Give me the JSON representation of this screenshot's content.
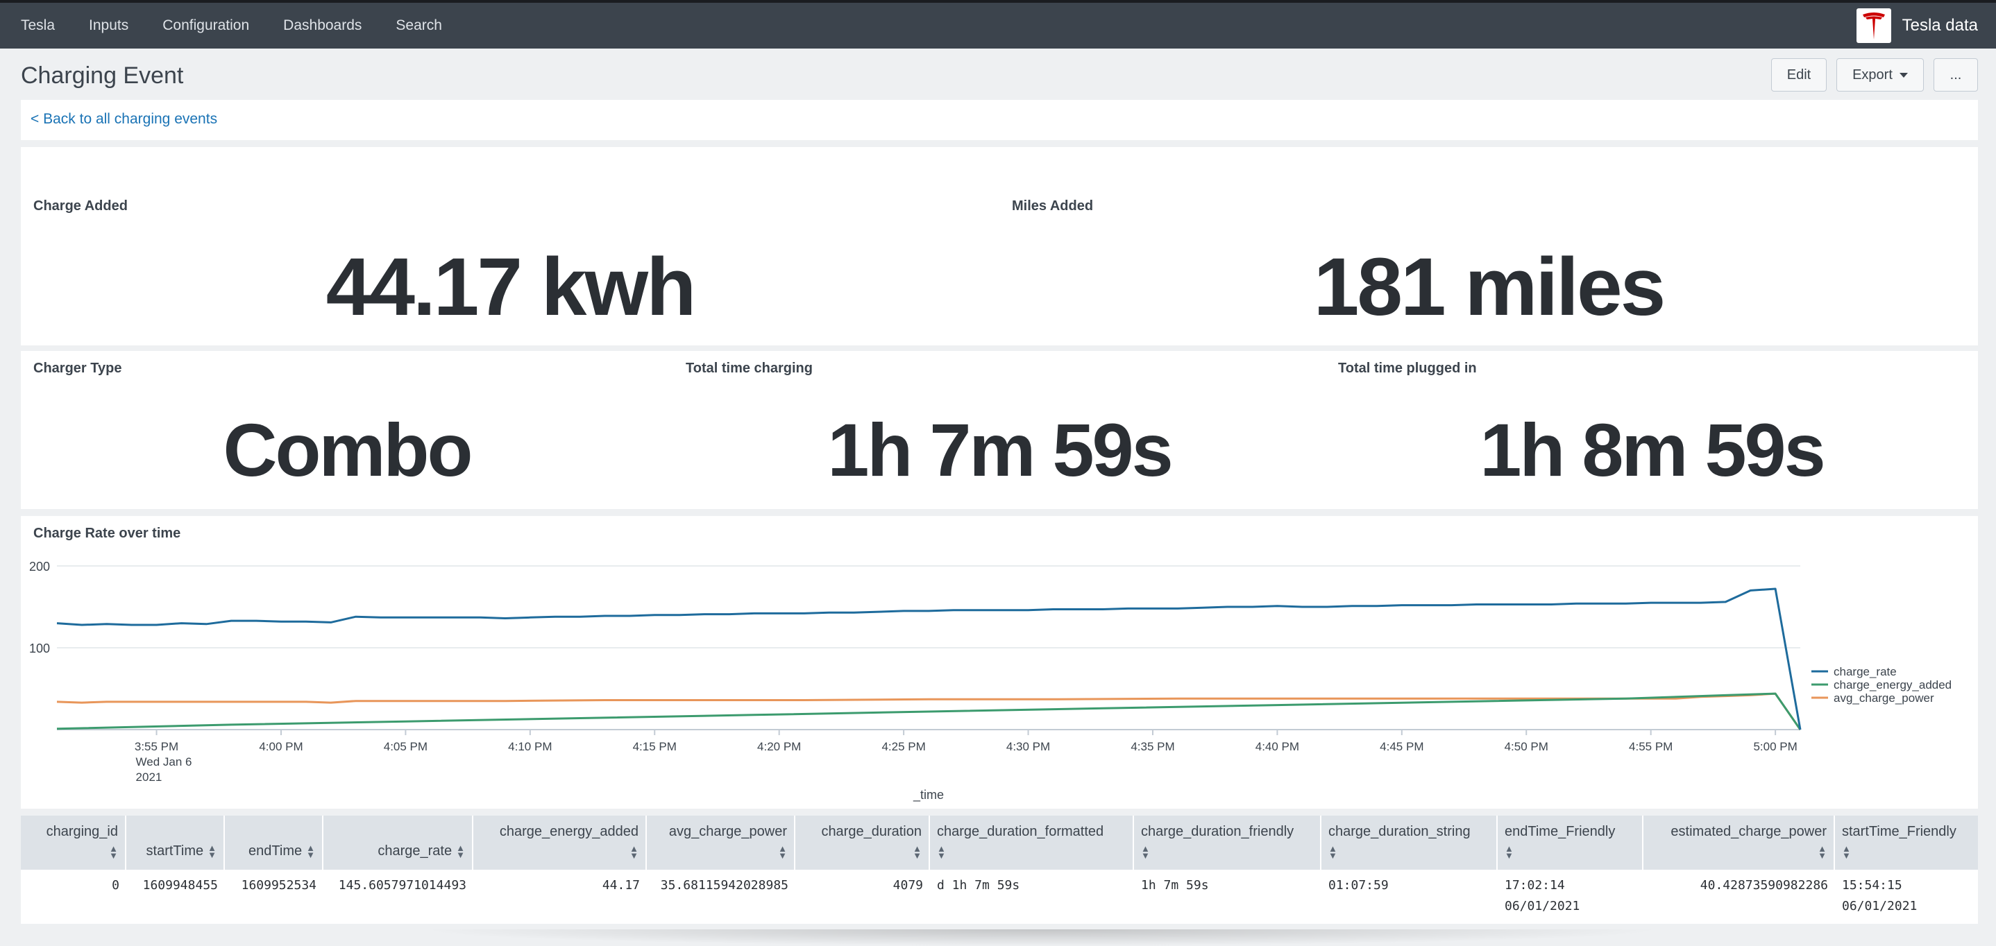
{
  "nav": {
    "items": [
      "Tesla",
      "Inputs",
      "Configuration",
      "Dashboards",
      "Search"
    ],
    "brand": "Tesla data"
  },
  "header": {
    "title": "Charging Event",
    "edit_label": "Edit",
    "export_label": "Export",
    "more_label": "..."
  },
  "back_link": "< Back to all charging events",
  "stats": {
    "charge_added": {
      "label": "Charge Added",
      "value": "44.17 kwh"
    },
    "miles_added": {
      "label": "Miles Added",
      "value": "181 miles"
    },
    "charger_type": {
      "label": "Charger Type",
      "value": "Combo"
    },
    "total_time_charging": {
      "label": "Total time charging",
      "value": "1h 7m 59s"
    },
    "total_time_plugged": {
      "label": "Total time plugged in",
      "value": "1h 8m 59s"
    }
  },
  "chart_data": {
    "type": "line",
    "title": "Charge Rate over time",
    "xlabel": "_time",
    "ylabel": "",
    "ylim": [
      0,
      200
    ],
    "y_ticks": [
      100,
      200
    ],
    "grid": true,
    "legend_position": "right",
    "x_ticks": [
      "3:55 PM",
      "4:00 PM",
      "4:05 PM",
      "4:10 PM",
      "4:15 PM",
      "4:20 PM",
      "4:25 PM",
      "4:30 PM",
      "4:35 PM",
      "4:40 PM",
      "4:45 PM",
      "4:50 PM",
      "4:55 PM",
      "5:00 PM"
    ],
    "x_tick_sub": [
      "Wed Jan 6",
      "2021"
    ],
    "x_range_minutes": [
      0,
      70
    ],
    "series": [
      {
        "name": "charge_rate",
        "color": "#1e6b9c",
        "x": [
          0,
          1,
          2,
          3,
          4,
          5,
          6,
          7,
          8,
          9,
          10,
          11,
          12,
          13,
          14,
          15,
          16,
          17,
          18,
          19,
          20,
          21,
          22,
          23,
          24,
          25,
          26,
          27,
          28,
          29,
          30,
          31,
          32,
          33,
          34,
          35,
          36,
          37,
          38,
          39,
          40,
          41,
          42,
          43,
          44,
          45,
          46,
          47,
          48,
          49,
          50,
          51,
          52,
          53,
          54,
          55,
          56,
          57,
          58,
          59,
          60,
          61,
          62,
          63,
          64,
          65,
          66,
          67,
          68,
          69,
          70
        ],
        "values": [
          130,
          128,
          129,
          128,
          128,
          130,
          129,
          133,
          133,
          132,
          132,
          131,
          138,
          137,
          137,
          137,
          137,
          137,
          136,
          137,
          138,
          138,
          139,
          139,
          140,
          140,
          141,
          141,
          142,
          142,
          142,
          143,
          143,
          144,
          145,
          145,
          146,
          146,
          146,
          146,
          147,
          147,
          147,
          148,
          148,
          148,
          149,
          150,
          150,
          151,
          150,
          150,
          151,
          151,
          152,
          152,
          152,
          153,
          153,
          153,
          153,
          154,
          154,
          154,
          155,
          155,
          155,
          156,
          170,
          172,
          0
        ]
      },
      {
        "name": "charge_energy_added",
        "color": "#3c9b6e",
        "x": [
          0,
          7,
          14,
          21,
          28,
          35,
          42,
          49,
          56,
          63,
          67,
          69,
          70
        ],
        "values": [
          1,
          6,
          10,
          14,
          18,
          22,
          26,
          30,
          34,
          38,
          42,
          44,
          0
        ]
      },
      {
        "name": "avg_charge_power",
        "color": "#e8965a",
        "x": [
          0,
          1,
          2,
          5,
          7,
          10,
          11,
          12,
          15,
          18,
          22,
          25,
          30,
          35,
          40,
          45,
          50,
          55,
          60,
          65,
          66,
          67,
          68,
          69,
          70
        ],
        "values": [
          34,
          33,
          34,
          34,
          34,
          34,
          33,
          35,
          35,
          35,
          36,
          36,
          36,
          37,
          37,
          38,
          38,
          38,
          38,
          38,
          40,
          41,
          42,
          44,
          0
        ]
      }
    ]
  },
  "table": {
    "columns": [
      "charging_id",
      "startTime",
      "endTime",
      "charge_rate",
      "charge_energy_added",
      "avg_charge_power",
      "charge_duration",
      "charge_duration_formatted",
      "charge_duration_friendly",
      "charge_duration_string",
      "endTime_Friendly",
      "estimated_charge_power",
      "startTime_Friendly"
    ],
    "rows": [
      [
        "0",
        "1609948455",
        "1609952534",
        "145.6057971014493",
        "44.17",
        "35.68115942028985",
        "4079",
        "d 1h 7m 59s",
        "1h 7m 59s",
        "01:07:59",
        "17:02:14\n06/01/2021",
        "40.42873590982286",
        "15:54:15\n06/01/2021"
      ]
    ]
  }
}
